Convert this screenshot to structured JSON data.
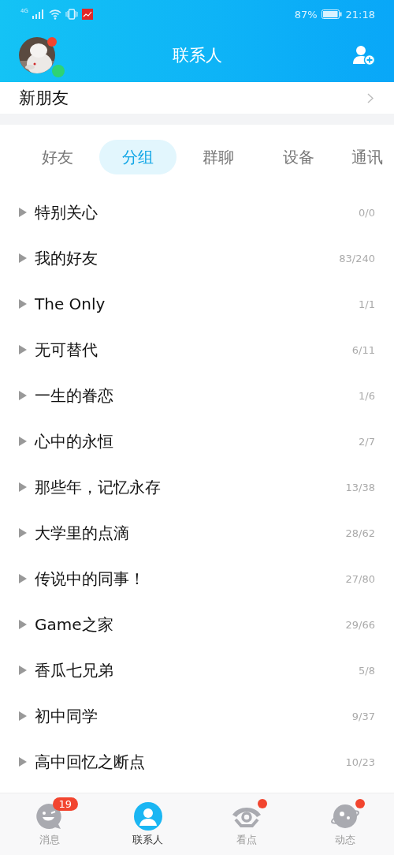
{
  "status_bar": {
    "network": "4G",
    "battery": "87%",
    "time": "21:18"
  },
  "header": {
    "title": "联系人",
    "avatar": {
      "unread_dot": true,
      "online": true
    }
  },
  "new_friends": {
    "label": "新朋友"
  },
  "tabs": [
    {
      "label": "好友",
      "selected": false
    },
    {
      "label": "分组",
      "selected": true
    },
    {
      "label": "群聊",
      "selected": false
    },
    {
      "label": "设备",
      "selected": false
    },
    {
      "label": "通讯",
      "selected": false
    }
  ],
  "groups": [
    {
      "name": "特别关心",
      "count": "0/0",
      "expanded": false
    },
    {
      "name": "我的好友",
      "count": "83/240",
      "expanded": false
    },
    {
      "name": "The Only",
      "count": "1/1",
      "expanded": false
    },
    {
      "name": "无可替代",
      "count": "6/11",
      "expanded": false
    },
    {
      "name": "一生的眷恋",
      "count": "1/6",
      "expanded": false
    },
    {
      "name": "心中的永恒",
      "count": "2/7",
      "expanded": false
    },
    {
      "name": "那些年，记忆永存",
      "count": "13/38",
      "expanded": false
    },
    {
      "name": "大学里的点滴",
      "count": "28/62",
      "expanded": false
    },
    {
      "name": "传说中的同事！",
      "count": "27/80",
      "expanded": false
    },
    {
      "name": "Game之家",
      "count": "29/66",
      "expanded": false
    },
    {
      "name": "香瓜七兄弟",
      "count": "5/8",
      "expanded": false
    },
    {
      "name": "初中同学",
      "count": "9/37",
      "expanded": false
    },
    {
      "name": "高中回忆之断点",
      "count": "10/23",
      "expanded": false
    }
  ],
  "bottom_nav": [
    {
      "kind": "messages",
      "label": "消息",
      "selected": false,
      "badge": "19",
      "dot": false
    },
    {
      "kind": "contacts",
      "label": "联系人",
      "selected": true,
      "dot": false
    },
    {
      "kind": "watch",
      "label": "看点",
      "selected": false,
      "dot": true
    },
    {
      "kind": "feed",
      "label": "动态",
      "selected": false,
      "dot": true
    }
  ]
}
